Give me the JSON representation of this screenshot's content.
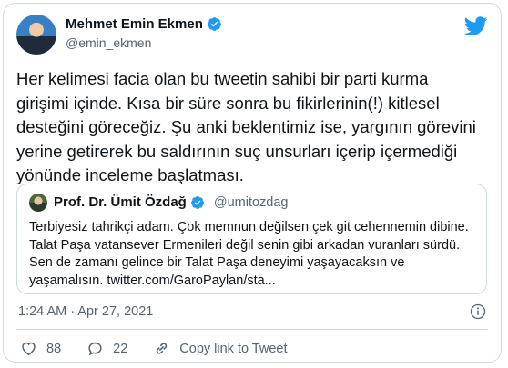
{
  "author": {
    "name": "Mehmet Emin Ekmen",
    "handle": "@emin_ekmen"
  },
  "tweet_text": "Her kelimesi facia olan bu tweetin sahibi bir parti kurma girişimi içinde. Kısa bir süre sonra bu fikirlerinin(!) kitlesel desteğini göreceğiz. Şu anki beklentimiz ise, yargının görevini yerine getirerek bu saldırının suç unsurları içerip içermediği yönünde inceleme başlatması.",
  "quoted": {
    "name": "Prof. Dr. Ümit Özdağ",
    "handle": "@umitozdag",
    "text": "Terbiyesiz tahrikçi adam. Çok memnun değilsen çek git cehennemin dibine. Talat Paşa vatansever Ermenileri değil senin gibi arkadan vuranları sürdü. Sen de zamanı gelince bir Talat Paşa deneyimi yaşayacaksın ve yaşamalısın. twitter.com/GaroPaylan/sta..."
  },
  "meta": {
    "timestamp": "1:24 AM · Apr 27, 2021"
  },
  "actions": {
    "likes": "88",
    "replies": "22",
    "copy_link": "Copy link to Tweet"
  },
  "colors": {
    "twitter_blue": "#1d9bf0",
    "like_red": "#e0245e",
    "secondary_text": "#536471"
  },
  "icons": [
    "twitter-bird-icon",
    "verified-badge-icon",
    "info-icon",
    "heart-icon",
    "reply-icon",
    "link-icon"
  ]
}
